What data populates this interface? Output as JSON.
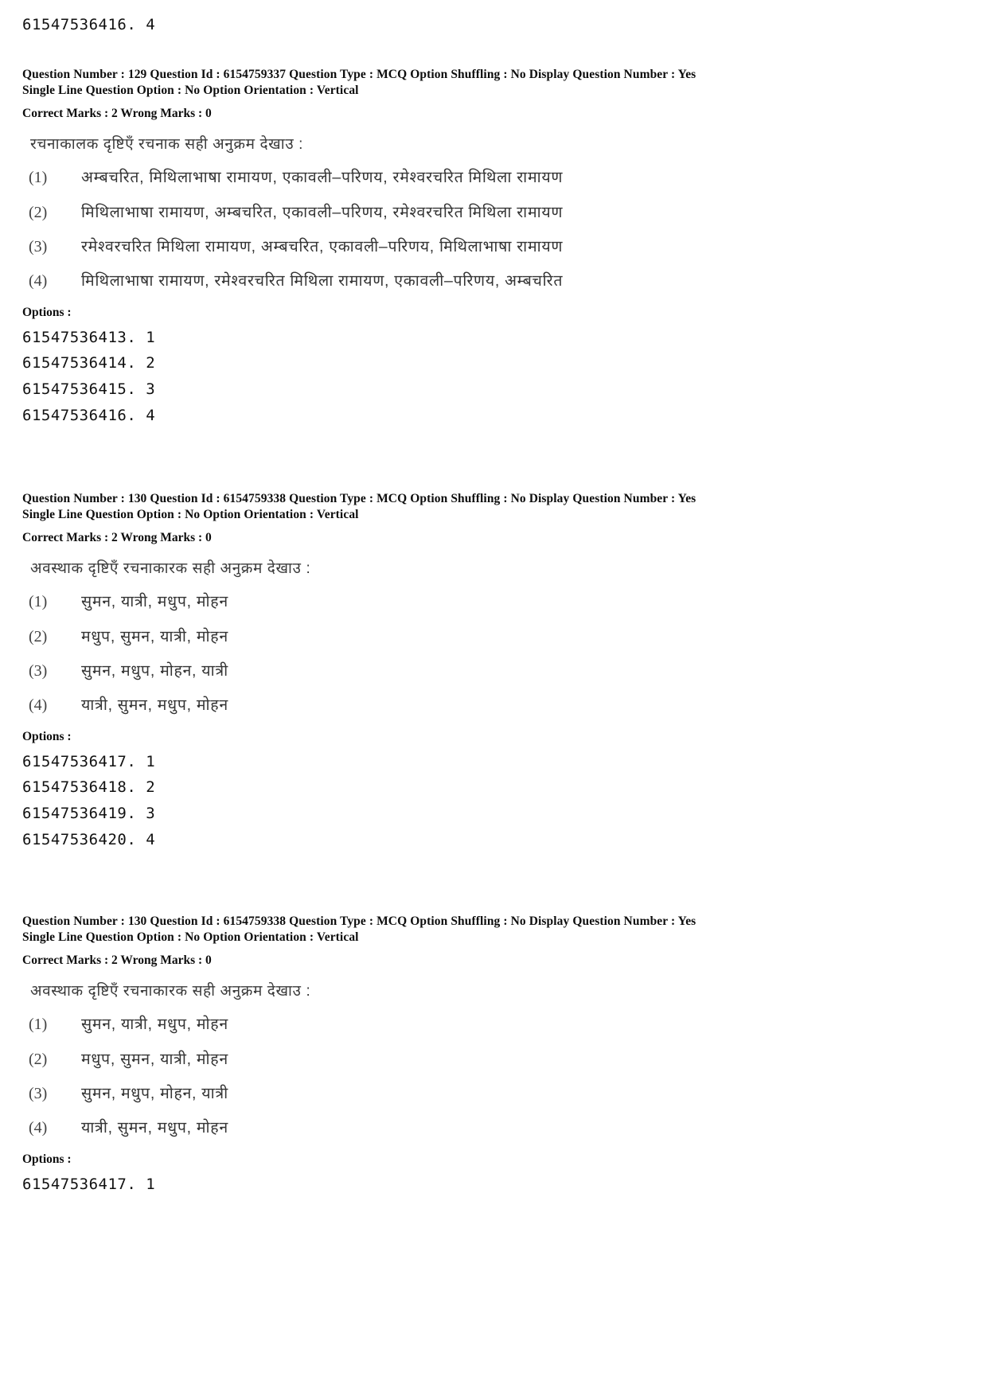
{
  "page": {
    "top_orphan_option_id": "61547536416. 4"
  },
  "questions": [
    {
      "meta_line_1": "Question Number : 129  Question Id : 6154759337  Question Type : MCQ  Option Shuffling : No  Display Question Number : Yes",
      "meta_line_2": "Single Line Question Option : No  Option Orientation : Vertical",
      "marks_line": "Correct Marks : 2  Wrong Marks : 0",
      "question_number": "129",
      "question_id": "6154759337",
      "question_type": "MCQ",
      "option_shuffling": "No",
      "display_question_number": "Yes",
      "single_line_question_option": "No",
      "option_orientation": "Vertical",
      "correct_marks": "2",
      "wrong_marks": "0",
      "stem": "रचनाकालक दृष्टिएँ रचनाक सही अनुक्रम देखाउ :",
      "choices": [
        {
          "num": "(1)",
          "text": "अम्बचरित, मिथिलाभाषा रामायण, एकावली–परिणय, रमेश्वरचरित मिथिला रामायण"
        },
        {
          "num": "(2)",
          "text": "मिथिलाभाषा रामायण, अम्बचरित, एकावली–परिणय, रमेश्वरचरित मिथिला रामायण"
        },
        {
          "num": "(3)",
          "text": "रमेश्वरचरित मिथिला रामायण, अम्बचरित, एकावली–परिणय, मिथिलाभाषा रामायण"
        },
        {
          "num": "(4)",
          "text": "मिथिलाभाषा रामायण, रमेश्वरचरित मिथिला रामायण, एकावली–परिणय, अम्बचरित"
        }
      ],
      "options_label": "Options :",
      "option_ids": [
        "61547536413. 1",
        "61547536414. 2",
        "61547536415. 3",
        "61547536416. 4"
      ]
    },
    {
      "meta_line_1": "Question Number : 130  Question Id : 6154759338  Question Type : MCQ  Option Shuffling : No  Display Question Number : Yes",
      "meta_line_2": "Single Line Question Option : No  Option Orientation : Vertical",
      "marks_line": "Correct Marks : 2  Wrong Marks : 0",
      "question_number": "130",
      "question_id": "6154759338",
      "question_type": "MCQ",
      "option_shuffling": "No",
      "display_question_number": "Yes",
      "single_line_question_option": "No",
      "option_orientation": "Vertical",
      "correct_marks": "2",
      "wrong_marks": "0",
      "stem": "अवस्थाक दृष्टिएँ रचनाकारक  सही अनुक्रम देखाउ :",
      "choices": [
        {
          "num": "(1)",
          "text": "सुमन, यात्री, मधुप, मोहन"
        },
        {
          "num": "(2)",
          "text": "मधुप, सुमन, यात्री, मोहन"
        },
        {
          "num": "(3)",
          "text": "सुमन, मधुप, मोहन, यात्री"
        },
        {
          "num": "(4)",
          "text": "यात्री, सुमन, मधुप, मोहन"
        }
      ],
      "options_label": "Options :",
      "option_ids": [
        "61547536417. 1",
        "61547536418. 2",
        "61547536419. 3",
        "61547536420. 4"
      ]
    },
    {
      "meta_line_1": "Question Number : 130  Question Id : 6154759338  Question Type : MCQ  Option Shuffling : No  Display Question Number : Yes",
      "meta_line_2": "Single Line Question Option : No  Option Orientation : Vertical",
      "marks_line": "Correct Marks : 2  Wrong Marks : 0",
      "question_number": "130",
      "question_id": "6154759338",
      "question_type": "MCQ",
      "option_shuffling": "No",
      "display_question_number": "Yes",
      "single_line_question_option": "No",
      "option_orientation": "Vertical",
      "correct_marks": "2",
      "wrong_marks": "0",
      "stem": "अवस्थाक दृष्टिएँ रचनाकारक  सही अनुक्रम देखाउ :",
      "choices": [
        {
          "num": "(1)",
          "text": "सुमन, यात्री, मधुप, मोहन"
        },
        {
          "num": "(2)",
          "text": "मधुप, सुमन, यात्री, मोहन"
        },
        {
          "num": "(3)",
          "text": "सुमन, मधुप, मोहन, यात्री"
        },
        {
          "num": "(4)",
          "text": "यात्री, सुमन, मधुप, मोहन"
        }
      ],
      "options_label": "Options :",
      "option_ids": [
        "61547536417. 1"
      ]
    }
  ]
}
